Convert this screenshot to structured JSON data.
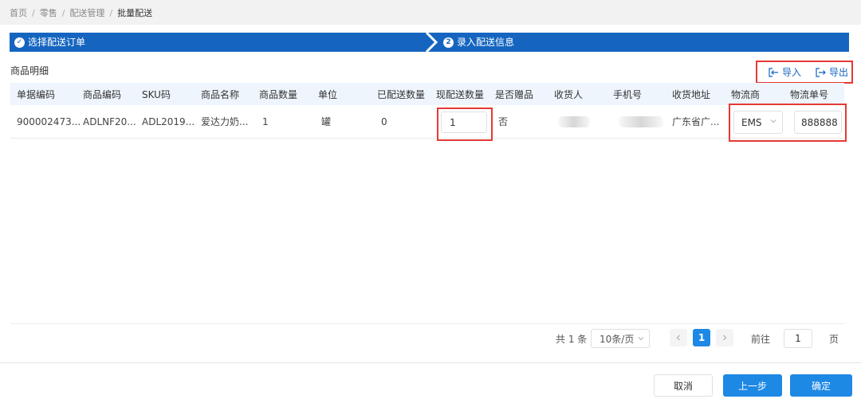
{
  "breadcrumb": [
    {
      "label": "首页"
    },
    {
      "label": "零售"
    },
    {
      "label": "配送管理"
    },
    {
      "label": "批量配送"
    }
  ],
  "steps": [
    {
      "label": "选择配送订单",
      "badge": "✓"
    },
    {
      "label": "录入配送信息",
      "badge": "2"
    }
  ],
  "section": {
    "title": "商品明细"
  },
  "actions": {
    "import_label": "导入",
    "export_label": "导出"
  },
  "table": {
    "headers": [
      "单据编码",
      "商品编码",
      "SKU码",
      "商品名称",
      "商品数量",
      "单位",
      "已配送数量",
      "现配送数量",
      "是否赠品",
      "收货人",
      "手机号",
      "收货地址",
      "物流商",
      "物流单号"
    ],
    "rows": [
      {
        "doc_code": "900002473...",
        "product_code": "ADLNF20...",
        "sku": "ADL2019...",
        "product_name": "爱达力奶...",
        "quantity": "1",
        "unit": "罐",
        "delivered_qty": "0",
        "current_qty": "1",
        "is_gift": "否",
        "receiver": "",
        "phone": "",
        "address": "广东省广...",
        "carrier": "EMS",
        "tracking_no": "888888"
      }
    ]
  },
  "pagination": {
    "total_label": "共 1 条",
    "page_size": "10条/页",
    "current_page": "1",
    "goto_prefix": "前往",
    "goto_value": "1",
    "goto_suffix": "页"
  },
  "buttons": {
    "cancel": "取消",
    "prev": "上一步",
    "confirm": "确定"
  },
  "colors": {
    "primary": "#1565c0",
    "accent": "#1e88e5",
    "highlight": "#e53935"
  }
}
